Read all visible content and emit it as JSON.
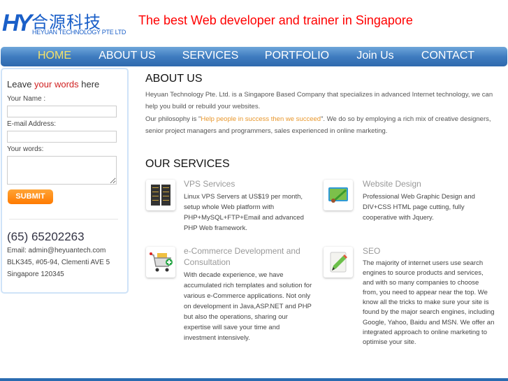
{
  "header": {
    "logo_mark": "HY",
    "logo_cn": "合源科技",
    "logo_en": "HEYUAN TECHNOLOGY PTE LTD",
    "tagline": "The best Web developer and trainer in Singapore"
  },
  "nav": [
    {
      "label": "HOME",
      "active": true
    },
    {
      "label": "ABOUT US"
    },
    {
      "label": "SERVICES"
    },
    {
      "label": "PORTFOLIO"
    },
    {
      "label": "Join Us"
    },
    {
      "label": "CONTACT"
    }
  ],
  "sidebar": {
    "title_pre": "Leave ",
    "title_em": "your words",
    "title_post": " here",
    "name_label": "Your Name :",
    "name_value": "",
    "email_label": "E-mail Address:",
    "email_value": "",
    "words_label": "Your words:",
    "words_value": "",
    "submit": "SUBMIT",
    "phone": "(65) 65202263",
    "email": "Email: admin@heyuantech.com",
    "address1": "BLK345, #05-94, Clementi AVE 5",
    "address2": "Singapore 120345"
  },
  "about": {
    "title": "ABOUT US",
    "p1": "Heyuan Technology Pte. Ltd. is a Singapore Based Company that specializes in advanced Internet technology, we can help you build or rebuild your websites.",
    "p2_pre": "Our philosophy is \"",
    "p2_em": "Help people in success then we succeed",
    "p2_post": "\". We do so by employing a rich mix of creative designers, senior project managers and programmers, sales experienced in online marketing."
  },
  "services": {
    "title": "OUR SERVICES",
    "items": [
      {
        "icon": "server-icon",
        "title": "VPS Services",
        "body": "Linux VPS Servers at US$19 per month, setup whole Web platform with PHP+MySQL+FTP+Email and advanced PHP Web framework."
      },
      {
        "icon": "paint-brush-icon",
        "title": "Website Design",
        "body": "Professional Web Graphic Design and DIV+CSS HTML page cutting, fully cooperative with Jquery."
      },
      {
        "icon": "shopping-cart-icon",
        "title": "e-Commerce Development and Consultation",
        "body": "With decade experience, we have accumulated rich templates and solution for various e-Commerce applications. Not only on development in Java,ASP.NET and PHP but also the operations, sharing our expertise will save your time and investment intensively."
      },
      {
        "icon": "pencil-document-icon",
        "title": "SEO",
        "body": "The majority of internet users use search engines to source products and services, and with so many companies to choose from, you need to appear near the top. We know all the tricks to make sure your site is found by the major search engines, including Google, Yahoo, Baidu and MSN. We offer an integrated approach to online marketing to optimise your site."
      }
    ]
  }
}
